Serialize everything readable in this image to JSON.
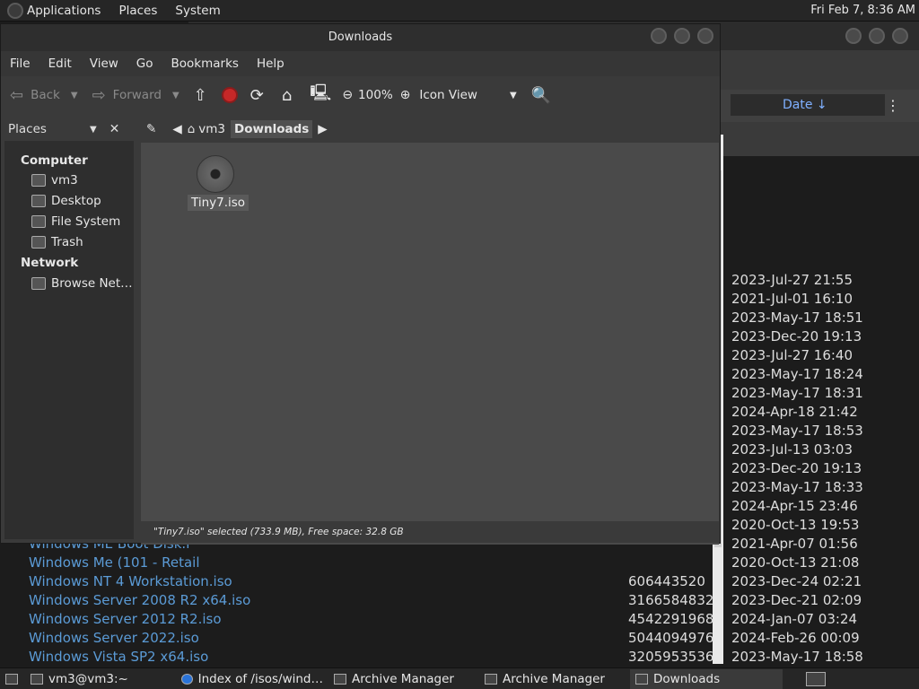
{
  "top_panel": {
    "applications": "Applications",
    "places": "Places",
    "system": "System",
    "clock": "Fri Feb  7,  8:36 AM"
  },
  "browser": {
    "date_header": "Date ↓",
    "rows": [
      {
        "name": "",
        "size": "",
        "date": "2023-Jul-27 21:55"
      },
      {
        "name": "",
        "size": "",
        "date": "2021-Jul-01 16:10"
      },
      {
        "name": "",
        "size": "",
        "date": "2023-May-17 18:51"
      },
      {
        "name": "",
        "size": "",
        "date": "2023-Dec-20 19:13"
      },
      {
        "name": "",
        "size": "",
        "date": "2023-Jul-27 16:40"
      },
      {
        "name": "",
        "size": "",
        "date": "2023-May-17 18:24"
      },
      {
        "name": "",
        "size": "",
        "date": "2023-May-17 18:31"
      },
      {
        "name": "",
        "size": "",
        "date": "2024-Apr-18 21:42"
      },
      {
        "name": "",
        "size": "",
        "date": "2023-May-17 18:53"
      },
      {
        "name": "",
        "size": "",
        "date": "2023-Jul-13 03:03"
      },
      {
        "name": "",
        "size": "",
        "date": "2023-Dec-20 19:13"
      },
      {
        "name": "",
        "size": "",
        "date": "2023-May-17 18:33"
      },
      {
        "name": "",
        "size": "",
        "date": "2024-Apr-15 23:46"
      },
      {
        "name": "",
        "size": "",
        "date": "2020-Oct-13 19:53"
      },
      {
        "name": "Windows ME Boot Disk.i",
        "size": "",
        "date": "2021-Apr-07 01:56"
      },
      {
        "name": "Windows Me (101 - Retail",
        "size": "",
        "date": "2020-Oct-13 21:08"
      },
      {
        "name": "Windows NT 4 Workstation.iso",
        "size": "606443520",
        "date": "2023-Dec-24 02:21"
      },
      {
        "name": "Windows Server 2008 R2 x64.iso",
        "size": "3166584832",
        "date": "2023-Dec-21 02:09"
      },
      {
        "name": "Windows Server 2012 R2.iso",
        "size": "4542291968",
        "date": "2024-Jan-07 03:24"
      },
      {
        "name": "Windows Server 2022.iso",
        "size": "5044094976",
        "date": "2024-Feb-26 00:09"
      },
      {
        "name": "Windows Vista SP2 x64.iso",
        "size": "3205953536",
        "date": "2023-May-17 18:58"
      }
    ]
  },
  "file_manager": {
    "title": "Downloads",
    "menu": [
      "File",
      "Edit",
      "View",
      "Go",
      "Bookmarks",
      "Help"
    ],
    "toolbar": {
      "back": "Back",
      "forward": "Forward",
      "zoom": "100%",
      "view_mode": "Icon View"
    },
    "sidebar": {
      "header": "Places",
      "computer_label": "Computer",
      "network_label": "Network",
      "computer_items": [
        "vm3",
        "Desktop",
        "File System",
        "Trash"
      ],
      "network_items": [
        "Browse Net…"
      ]
    },
    "path": [
      "vm3",
      "Downloads"
    ],
    "files": [
      {
        "name": "Tiny7.iso"
      }
    ],
    "status": "\"Tiny7.iso\" selected (733.9 MB), Free space: 32.8 GB"
  },
  "taskbar": {
    "items": [
      {
        "label": "vm3@vm3:~"
      },
      {
        "label": "Index of /isos/wind…"
      },
      {
        "label": "Archive Manager"
      },
      {
        "label": "Archive Manager"
      },
      {
        "label": "Downloads"
      }
    ]
  }
}
